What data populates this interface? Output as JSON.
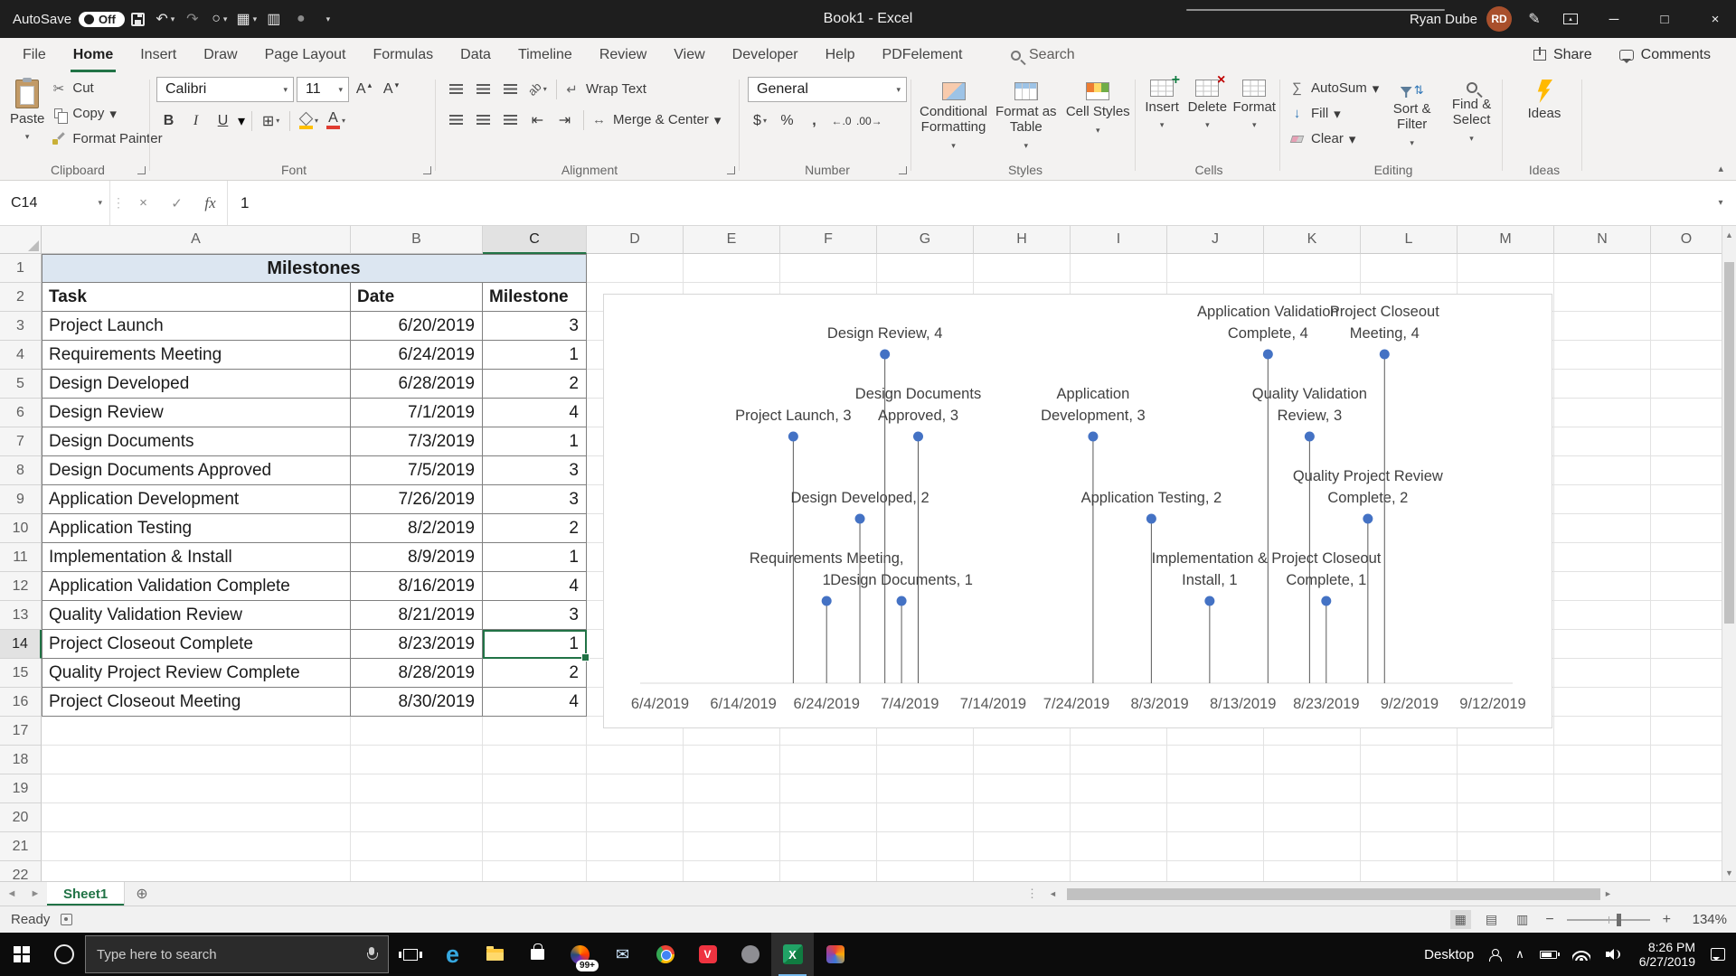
{
  "titlebar": {
    "autosave_label": "AutoSave",
    "autosave_state": "Off",
    "title": "Book1 - Excel",
    "user_name": "Ryan Dube",
    "user_initials": "RD"
  },
  "active_tab": "Home",
  "ribbon_tabs": [
    "File",
    "Home",
    "Insert",
    "Draw",
    "Page Layout",
    "Formulas",
    "Data",
    "Timeline",
    "Review",
    "View",
    "Developer",
    "Help",
    "PDFelement"
  ],
  "top_right": {
    "search": "Search",
    "share": "Share",
    "comments": "Comments"
  },
  "icons": {
    "dropdown": "▾",
    "undo": "↶",
    "redo": "↷",
    "touch_mode": "○",
    "quick_table": "▦",
    "quick_grid": "▥",
    "record_dot": "●",
    "pen": "✎",
    "minimize": "─",
    "maximize": "□",
    "close": "×",
    "scissors": "✂",
    "borders": "⊞",
    "font_a": "A",
    "grow_arrow": "▴",
    "wrap_text": "↵",
    "merge_center": "↔",
    "indent_decrease": "⇤",
    "indent_increase": "⇥",
    "orientation": "ab",
    "sum": "∑",
    "fill_down": "↓",
    "sort_arrows": "⇅",
    "collapse": "▴",
    "ellipsis_v": "⋮",
    "cancel": "×",
    "enter": "✓",
    "fx": "fx",
    "scroll_up": "▲",
    "scroll_down": "▼",
    "nav_left": "◄",
    "nav_right": "►",
    "add_sheet": "⊕",
    "view_normal": "▦",
    "view_layout": "▤",
    "view_break": "▥",
    "minus": "−",
    "plus": "+",
    "edge": "e",
    "envelope": "✉",
    "vivaldi": "V",
    "excel_x": "X",
    "chevron_up": "∧"
  },
  "ribbon": {
    "clipboard": {
      "group": "Clipboard",
      "paste": "Paste",
      "cut": "Cut",
      "copy": "Copy",
      "format_painter": "Format Painter"
    },
    "font": {
      "group": "Font",
      "name": "Calibri",
      "size": "11",
      "bold": "B",
      "italic": "I",
      "underline": "U"
    },
    "alignment": {
      "group": "Alignment",
      "wrap": "Wrap Text",
      "merge": "Merge & Center"
    },
    "number": {
      "group": "Number",
      "format": "General",
      "currency": "$",
      "percent": "%",
      "comma": ",",
      "increase_decimal": "←.0",
      "decrease_decimal": ".00→"
    },
    "styles": {
      "group": "Styles",
      "conditional": "Conditional Formatting",
      "format_table": "Format as Table",
      "cell_styles": "Cell Styles"
    },
    "cells": {
      "group": "Cells",
      "insert": "Insert",
      "delete": "Delete",
      "format": "Format"
    },
    "editing": {
      "group": "Editing",
      "autosum": "AutoSum",
      "fill": "Fill",
      "clear": "Clear",
      "sort": "Sort & Filter",
      "find": "Find & Select"
    },
    "ideas": {
      "group": "Ideas",
      "button": "Ideas"
    }
  },
  "formula_bar": {
    "name_box": "C14",
    "content": "1"
  },
  "sheet": {
    "columns": [
      "A",
      "B",
      "C",
      "D",
      "E",
      "F",
      "G",
      "H",
      "I",
      "J",
      "K",
      "L",
      "M",
      "N",
      "O"
    ],
    "rows_visible": 22,
    "selected_cell": {
      "column": "C",
      "row": 14
    },
    "table": {
      "title": "Milestones",
      "title_fill": "#DCE6F1",
      "headers": [
        "Task",
        "Date",
        "Milestone"
      ],
      "rows": [
        [
          "Project Launch",
          "6/20/2019",
          "3"
        ],
        [
          "Requirements Meeting",
          "6/24/2019",
          "1"
        ],
        [
          "Design Developed",
          "6/28/2019",
          "2"
        ],
        [
          "Design Review",
          "7/1/2019",
          "4"
        ],
        [
          "Design Documents",
          "7/3/2019",
          "1"
        ],
        [
          "Design Documents Approved",
          "7/5/2019",
          "3"
        ],
        [
          "Application Development",
          "7/26/2019",
          "3"
        ],
        [
          "Application Testing",
          "8/2/2019",
          "2"
        ],
        [
          "Implementation & Install",
          "8/9/2019",
          "1"
        ],
        [
          "Application Validation Complete",
          "8/16/2019",
          "4"
        ],
        [
          "Quality Validation Review",
          "8/21/2019",
          "3"
        ],
        [
          "Project Closeout Complete",
          "8/23/2019",
          "1"
        ],
        [
          "Quality Project Review Complete",
          "8/28/2019",
          "2"
        ],
        [
          "Project Closeout Meeting",
          "8/30/2019",
          "4"
        ]
      ]
    }
  },
  "chart_data": {
    "type": "scatter",
    "subtype": "milestone-stem-chart",
    "x_ticks": [
      "6/4/2019",
      "6/14/2019",
      "6/24/2019",
      "7/4/2019",
      "7/14/2019",
      "7/24/2019",
      "8/3/2019",
      "8/13/2019",
      "8/23/2019",
      "9/2/2019",
      "9/12/2019"
    ],
    "y_range": [
      0,
      4.5
    ],
    "grid": "off",
    "legend": "none",
    "marker_color": "#4472C4",
    "stem_color": "#595959",
    "axis_color": "#D9D9D9",
    "label_color": "#404040",
    "points": [
      {
        "name": "Project Launch",
        "date": "6/20/2019",
        "value": 3,
        "label_lines": [
          "Project Launch, 3"
        ]
      },
      {
        "name": "Requirements Meeting",
        "date": "6/24/2019",
        "value": 1,
        "label_lines": [
          "Requirements Meeting,",
          "1"
        ]
      },
      {
        "name": "Design Developed",
        "date": "6/28/2019",
        "value": 2,
        "label_lines": [
          "Design Developed, 2"
        ]
      },
      {
        "name": "Design Review",
        "date": "7/1/2019",
        "value": 4,
        "label_lines": [
          "Design Review, 4"
        ]
      },
      {
        "name": "Design Documents",
        "date": "7/3/2019",
        "value": 1,
        "label_lines": [
          "Design Documents, 1"
        ]
      },
      {
        "name": "Design Documents Approved",
        "date": "7/5/2019",
        "value": 3,
        "label_lines": [
          "Design Documents",
          "Approved, 3"
        ]
      },
      {
        "name": "Application Development",
        "date": "7/26/2019",
        "value": 3,
        "label_lines": [
          "Application",
          "Development, 3"
        ]
      },
      {
        "name": "Application Testing",
        "date": "8/2/2019",
        "value": 2,
        "label_lines": [
          "Application Testing, 2"
        ]
      },
      {
        "name": "Implementation & Install",
        "date": "8/9/2019",
        "value": 1,
        "label_lines": [
          "Implementation &",
          "Install, 1"
        ]
      },
      {
        "name": "Application Validation Complete",
        "date": "8/16/2019",
        "value": 4,
        "label_lines": [
          "Application Validation",
          "Complete, 4"
        ]
      },
      {
        "name": "Quality Validation Review",
        "date": "8/21/2019",
        "value": 3,
        "label_lines": [
          "Quality Validation",
          "Review, 3"
        ]
      },
      {
        "name": "Project Closeout Complete",
        "date": "8/23/2019",
        "value": 1,
        "label_lines": [
          "Project Closeout",
          "Complete, 1"
        ]
      },
      {
        "name": "Quality Project Review Complete",
        "date": "8/28/2019",
        "value": 2,
        "label_lines": [
          "Quality Project Review",
          "Complete, 2"
        ]
      },
      {
        "name": "Project Closeout Meeting",
        "date": "8/30/2019",
        "value": 4,
        "label_lines": [
          "Project Closeout",
          "Meeting, 4"
        ]
      }
    ]
  },
  "sheet_tabs": {
    "active": "Sheet1"
  },
  "status_bar": {
    "status": "Ready",
    "zoom": "134%"
  },
  "taskbar": {
    "search_placeholder": "Type here to search",
    "badge": "99+",
    "desktop": "Desktop",
    "time": "8:26 PM",
    "date": "6/27/2019"
  }
}
